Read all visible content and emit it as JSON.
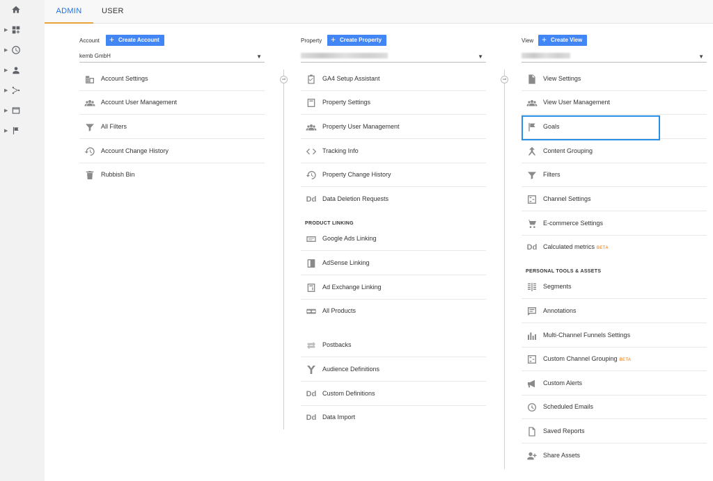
{
  "tabs": {
    "admin": "ADMIN",
    "user": "USER"
  },
  "account": {
    "label": "Account",
    "create_label": "Create Account",
    "selected": "kemb GmbH",
    "items": [
      {
        "label": "Account Settings",
        "icon": "building-icon"
      },
      {
        "label": "Account User Management",
        "icon": "users-icon"
      },
      {
        "label": "All Filters",
        "icon": "filter-icon"
      },
      {
        "label": "Account Change History",
        "icon": "history-icon"
      },
      {
        "label": "Rubbish Bin",
        "icon": "trash-icon"
      }
    ]
  },
  "property": {
    "label": "Property",
    "create_label": "Create Property",
    "selected": "",
    "items": [
      {
        "label": "GA4 Setup Assistant",
        "icon": "checklist-icon"
      },
      {
        "label": "Property Settings",
        "icon": "settings-page-icon"
      },
      {
        "label": "Property User Management",
        "icon": "users-icon"
      },
      {
        "label": "Tracking Info",
        "icon": "code-icon"
      },
      {
        "label": "Property Change History",
        "icon": "history-icon"
      },
      {
        "label": "Data Deletion Requests",
        "icon": "dd-icon"
      }
    ],
    "section_title": "PRODUCT LINKING",
    "linking_items": [
      {
        "label": "Google Ads Linking",
        "icon": "ads-icon"
      },
      {
        "label": "AdSense Linking",
        "icon": "adsense-icon"
      },
      {
        "label": "Ad Exchange Linking",
        "icon": "adexchange-icon"
      },
      {
        "label": "All Products",
        "icon": "link-icon"
      }
    ],
    "other_items": [
      {
        "label": "Postbacks",
        "icon": "arrows-icon"
      },
      {
        "label": "Audience Definitions",
        "icon": "audience-icon"
      },
      {
        "label": "Custom Definitions",
        "icon": "dd-icon"
      },
      {
        "label": "Data Import",
        "icon": "dd-icon"
      }
    ]
  },
  "view": {
    "label": "View",
    "create_label": "Create View",
    "selected": "",
    "items": [
      {
        "label": "View Settings",
        "icon": "document-icon"
      },
      {
        "label": "View User Management",
        "icon": "users-icon"
      },
      {
        "label": "Goals",
        "icon": "flag-icon"
      },
      {
        "label": "Content Grouping",
        "icon": "grouping-icon"
      },
      {
        "label": "Filters",
        "icon": "filter-icon"
      },
      {
        "label": "Channel Settings",
        "icon": "channel-icon"
      },
      {
        "label": "E-commerce Settings",
        "icon": "cart-icon"
      },
      {
        "label": "Calculated metrics",
        "icon": "dd-icon",
        "beta": "BETA"
      }
    ],
    "section_title": "PERSONAL TOOLS & ASSETS",
    "tools_items": [
      {
        "label": "Segments",
        "icon": "segments-icon"
      },
      {
        "label": "Annotations",
        "icon": "annotation-icon"
      },
      {
        "label": "Multi-Channel Funnels Settings",
        "icon": "bars-icon"
      },
      {
        "label": "Custom Channel Grouping",
        "icon": "channel-icon",
        "beta": "BETA"
      },
      {
        "label": "Custom Alerts",
        "icon": "megaphone-icon"
      },
      {
        "label": "Scheduled Emails",
        "icon": "clock-icon"
      },
      {
        "label": "Saved Reports",
        "icon": "saved-report-icon"
      },
      {
        "label": "Share Assets",
        "icon": "share-icon"
      }
    ]
  },
  "colors": {
    "accent": "#4285f4",
    "tab_active": "#1a73e8",
    "tab_underline": "#e8a33a",
    "beta": "#e8710a",
    "highlight": "#2a8fe6"
  }
}
